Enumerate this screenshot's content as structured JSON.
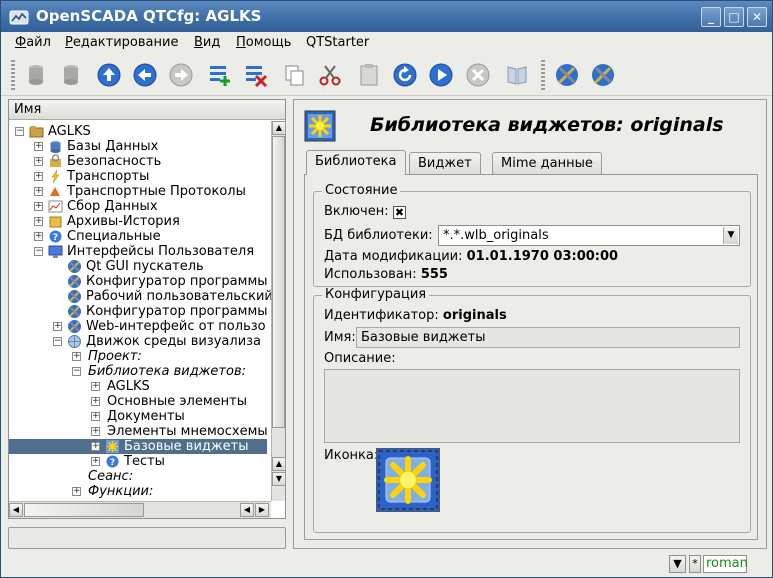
{
  "window": {
    "title": "OpenSCADA QTCfg: AGLKS"
  },
  "menu": [
    {
      "u": "Ф",
      "rest": "айл"
    },
    {
      "u": "Р",
      "rest": "едактирование"
    },
    {
      "u": "В",
      "rest": "ид"
    },
    {
      "u": "П",
      "rest": "омощь"
    },
    {
      "u": "",
      "rest": "QTStarter"
    }
  ],
  "tree": {
    "header": "Имя",
    "rows": [
      {
        "label": "AGLKS"
      },
      {
        "label": "Базы Данных"
      },
      {
        "label": "Безопасность"
      },
      {
        "label": "Транспорты"
      },
      {
        "label": "Транспортные Протоколы"
      },
      {
        "label": "Сбор Данных"
      },
      {
        "label": "Архивы-История"
      },
      {
        "label": "Специальные"
      },
      {
        "label": "Интерфейсы Пользователя"
      },
      {
        "label": "Qt GUI пускатель"
      },
      {
        "label": "Конфигуратор программы"
      },
      {
        "label": "Рабочий пользовательский"
      },
      {
        "label": "Конфигуратор программы"
      },
      {
        "label": "Web-интерфейс от пользо"
      },
      {
        "label": "Движок среды визуализа"
      },
      {
        "label": "Проект:"
      },
      {
        "label": "Библиотека виджетов:"
      },
      {
        "label": "AGLKS"
      },
      {
        "label": "Основные элементы"
      },
      {
        "label": "Документы"
      },
      {
        "label": "Элементы мнемосхемы"
      },
      {
        "label": "Базовые виджеты"
      },
      {
        "label": "Тесты"
      },
      {
        "label": "Сеанс:"
      },
      {
        "label": "Функции:"
      }
    ]
  },
  "page": {
    "title": "Библиотека виджетов: originals",
    "tabs": [
      "Библиотека",
      "Виджет",
      "Mime данные"
    ],
    "state": {
      "group_title": "Состояние",
      "enabled_label": "Включен:",
      "enabled_mark": "✖",
      "db_label": "БД библиотеки:",
      "db_value": "*.*.wlb_originals",
      "modified_label": "Дата модификации:",
      "modified_value": "01.01.1970 03:00:00",
      "used_label": "Использован:",
      "used_value": "555"
    },
    "config": {
      "group_title": "Конфигурация",
      "id_label": "Идентификатор:",
      "id_value": "originals",
      "name_label": "Имя:",
      "name_value": "Базовые виджеты",
      "desc_label": "Описание:",
      "icon_label": "Иконка:"
    }
  },
  "statusbar": {
    "star": "*",
    "user": "roman"
  }
}
